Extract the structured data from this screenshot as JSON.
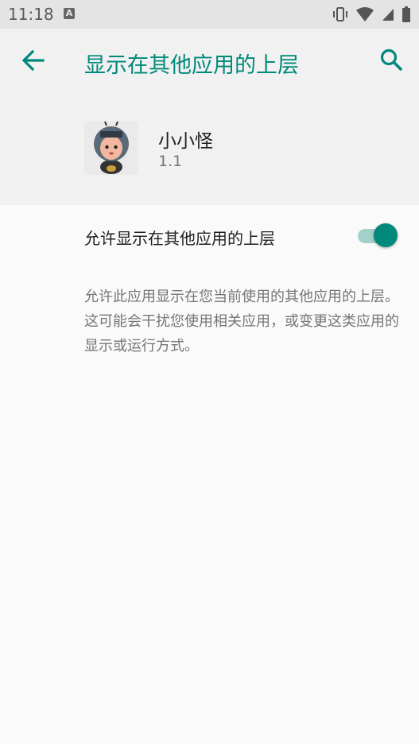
{
  "status_bar": {
    "time": "11:18",
    "notification_icon": "a-icon",
    "icons": [
      "vibrate-icon",
      "wifi-icon",
      "cellular-icon",
      "battery-icon"
    ]
  },
  "app_bar": {
    "title": "显示在其他应用的上层",
    "back_icon": "arrow-back-icon",
    "search_icon": "search-icon"
  },
  "app_info": {
    "name": "小小怪",
    "version": "1.1"
  },
  "setting": {
    "label": "允许显示在其他应用的上层",
    "enabled": true,
    "description": "允许此应用显示在您当前使用的其他应用的上层。这可能会干扰您使用相关应用，或变更这类应用的显示或运行方式。"
  },
  "colors": {
    "accent": "#00897b",
    "toggle_track": "#a4cfca",
    "header_bg": "#f1f1f1",
    "page_bg": "#fafafa",
    "status_bar_bg": "#e4e4e4"
  }
}
